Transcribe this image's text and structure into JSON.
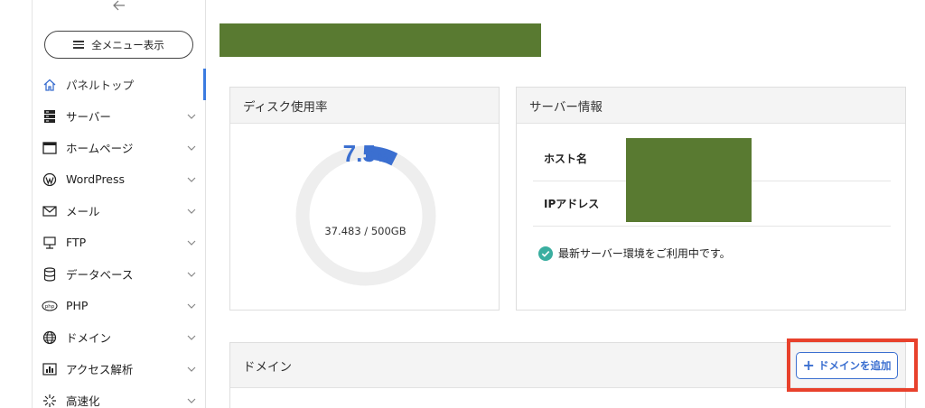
{
  "sidebar": {
    "menu_button_label": "全メニュー表示",
    "items": [
      {
        "label": "パネルトップ",
        "icon": "home-icon",
        "active": true
      },
      {
        "label": "サーバー",
        "icon": "server-icon"
      },
      {
        "label": "ホームページ",
        "icon": "browser-window-icon"
      },
      {
        "label": "WordPress",
        "icon": "wordpress-icon"
      },
      {
        "label": "メール",
        "icon": "mail-icon"
      },
      {
        "label": "FTP",
        "icon": "ftp-icon"
      },
      {
        "label": "データベース",
        "icon": "database-icon"
      },
      {
        "label": "PHP",
        "icon": "php-icon"
      },
      {
        "label": "ドメイン",
        "icon": "globe-icon"
      },
      {
        "label": "アクセス解析",
        "icon": "analytics-icon"
      },
      {
        "label": "高速化",
        "icon": "speedup-icon"
      }
    ]
  },
  "disk": {
    "title": "ディスク使用率",
    "percent": "7.5",
    "percent_unit": "%",
    "usage_text": "37.483 / 500GB",
    "fraction": 0.075,
    "accent_color": "#3b6fd0"
  },
  "server": {
    "title": "サーバー情報",
    "host_label": "ホスト名",
    "ip_label": "IPアドレス",
    "status_text": "最新サーバー環境をご利用中です。",
    "status_color": "#3aaea0"
  },
  "domain": {
    "title": "ドメイン",
    "add_button_label": "ドメインを追加"
  },
  "colors": {
    "redaction": "#597a31",
    "highlight": "#e8412c"
  }
}
